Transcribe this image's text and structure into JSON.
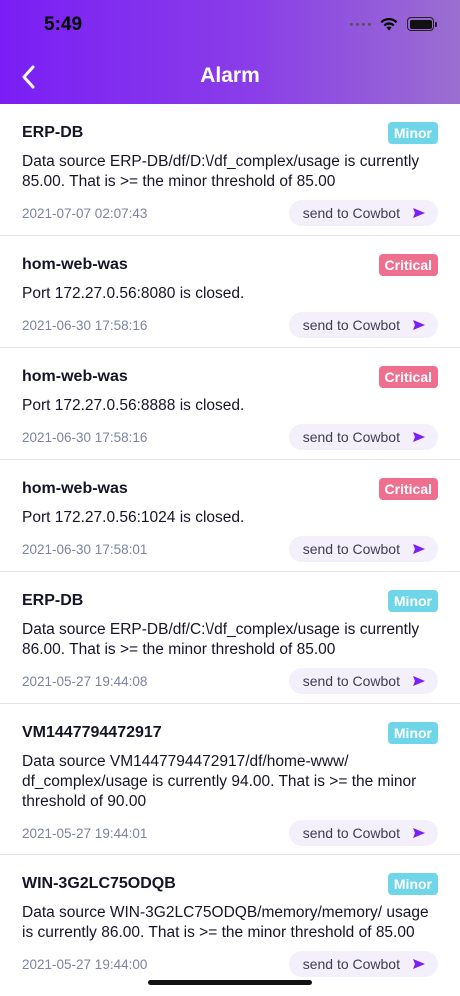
{
  "status": {
    "time": "5:49"
  },
  "header": {
    "title": "Alarm"
  },
  "colors": {
    "accent": "#7a1ef5",
    "minor": "#6fd5e8",
    "critical": "#ef6f8f",
    "send_icon": "#7a1ef5"
  },
  "alarms": [
    {
      "host": "ERP-DB",
      "severity": "Minor",
      "message": "Data source ERP-DB/df/D:\\/df_complex/usage is currently 85.00. That is >= the minor threshold of 85.00",
      "time": "2021-07-07 02:07:43",
      "action": "send to Cowbot"
    },
    {
      "host": "hom-web-was",
      "severity": "Critical",
      "message": "Port 172.27.0.56:8080 is closed.",
      "time": "2021-06-30 17:58:16",
      "action": "send to Cowbot"
    },
    {
      "host": "hom-web-was",
      "severity": "Critical",
      "message": "Port 172.27.0.56:8888 is closed.",
      "time": "2021-06-30 17:58:16",
      "action": "send to Cowbot"
    },
    {
      "host": "hom-web-was",
      "severity": "Critical",
      "message": "Port 172.27.0.56:1024 is closed.",
      "time": "2021-06-30 17:58:01",
      "action": "send to Cowbot"
    },
    {
      "host": "ERP-DB",
      "severity": "Minor",
      "message": "Data source ERP-DB/df/C:\\/df_complex/usage is currently 86.00. That is >= the minor threshold of 85.00",
      "time": "2021-05-27 19:44:08",
      "action": "send to Cowbot"
    },
    {
      "host": "VM1447794472917",
      "severity": "Minor",
      "message": "Data source VM1447794472917/df/home-www/ df_complex/usage is currently 94.00. That is >= the minor threshold of 90.00",
      "time": "2021-05-27 19:44:01",
      "action": "send to Cowbot"
    },
    {
      "host": "WIN-3G2LC75ODQB",
      "severity": "Minor",
      "message": "Data source WIN-3G2LC75ODQB/memory/memory/ usage is currently 86.00. That is >= the minor threshold of 85.00",
      "time": "2021-05-27 19:44:00",
      "action": "send to Cowbot"
    }
  ]
}
